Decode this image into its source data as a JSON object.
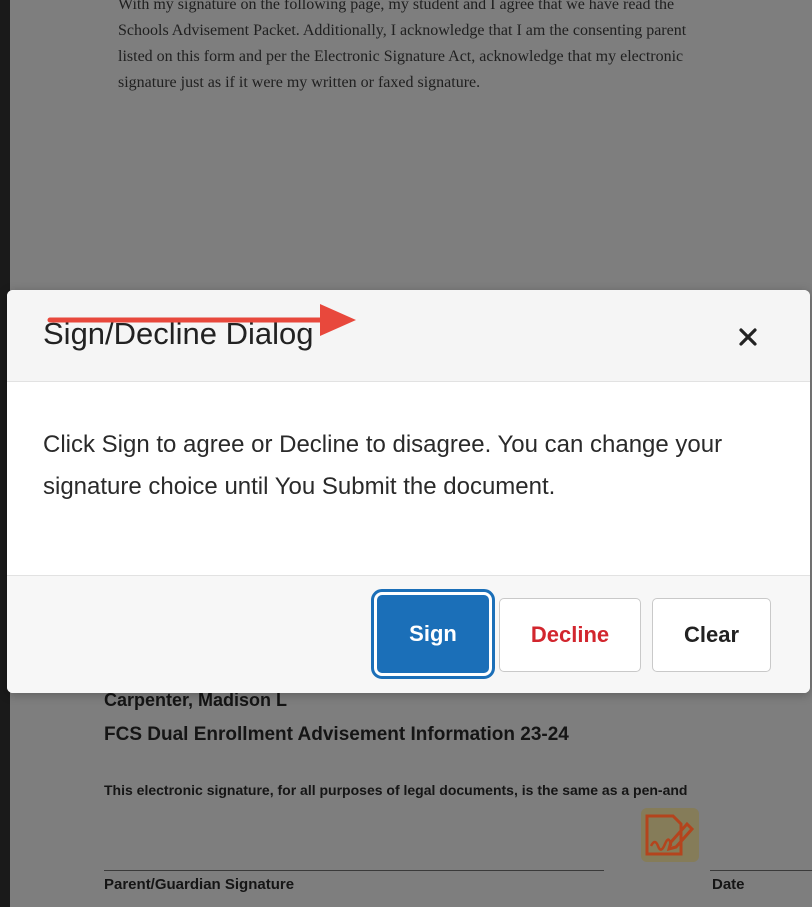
{
  "document": {
    "paragraph_lines": [
      "With my signature on the following page, my student and I agree that we have read the",
      "Schools Advisement Packet.  Additionally,  I acknowledge that I am the consenting parent",
      "listed on this form and per the Electronic Signature Act, acknowledge that my electronic",
      "signature just as if it were my written or faxed signature."
    ],
    "student_name": "Carpenter, Madison L",
    "form_title": "FCS Dual Enrollment Advisement Information 23-24",
    "legal_notice": "This electronic signature, for all purposes of legal documents, is the same as a pen-and",
    "signature_label": "Parent/Guardian Signature",
    "date_label": "Date",
    "sign_here_icon": "signature-pen-icon"
  },
  "dialog": {
    "title": "Sign/Decline Dialog",
    "close_icon": "close-icon",
    "message": "Click Sign to agree or Decline to disagree. You can change your signature choice until You Submit the document.",
    "buttons": {
      "sign": "Sign",
      "decline": "Decline",
      "clear": "Clear"
    }
  },
  "annotation": {
    "arrow_icon": "red-arrow-right-icon",
    "arrow_color": "#e8483c"
  },
  "colors": {
    "sign_blue": "#1b6fb8",
    "decline_red": "#d2262e",
    "dim_overlay": "#7e7e7e"
  }
}
